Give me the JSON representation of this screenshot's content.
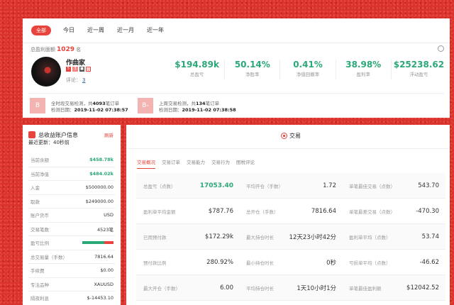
{
  "filters": [
    {
      "label": "全部",
      "active": true
    },
    {
      "label": "今日",
      "active": false
    },
    {
      "label": "近一周",
      "active": false
    },
    {
      "label": "近一月",
      "active": false
    },
    {
      "label": "近一年",
      "active": false
    }
  ],
  "profile": {
    "total_profit_prefix": "总盈利面额",
    "total_profit_value": "1029",
    "total_profit_suffix": "名",
    "name": "作曲家",
    "badges": [
      "5",
      "3",
      "■",
      "◎"
    ],
    "rating_label": "评论：",
    "rating_value": "3"
  },
  "stats": [
    {
      "value": "$194.89k",
      "label": "总盈亏"
    },
    {
      "value": "50.14%",
      "label": "净胜率"
    },
    {
      "value": "0.41%",
      "label": "净值回撤率"
    },
    {
      "value": "38.98%",
      "label": "盈利率"
    },
    {
      "value": "$25238.62",
      "label": "浮动盈亏"
    }
  ],
  "checks": [
    {
      "icon": "B",
      "line1_pre": "全时段交易检测，共",
      "line1_num": "4093",
      "line1_post": "笔订单",
      "line2_label": "检测日期：",
      "line2_date": "2019-11-02 07:38:57"
    },
    {
      "icon": "B-",
      "line1_pre": "上周交易检测，共",
      "line1_num": "134",
      "line1_post": "笔订单",
      "line2_label": "检测日期：",
      "line2_date": "2019-11-02 07:38:58"
    }
  ],
  "account": {
    "title": "总收益账户信息",
    "refresh": "刷新",
    "update": "最近更新：40秒前",
    "loss_ratio": 0.7,
    "rows": [
      {
        "label": "当前余额",
        "value": "$458.78k",
        "style": "green"
      },
      {
        "label": "当前净值",
        "value": "$484.02k",
        "style": "green"
      },
      {
        "label": "入金",
        "value": "$500000.00",
        "style": ""
      },
      {
        "label": "取款",
        "value": "$249000.00",
        "style": ""
      },
      {
        "label": "账户货币",
        "value": "USD",
        "style": ""
      },
      {
        "label": "交易笔数",
        "value": "4523笔",
        "style": ""
      },
      {
        "label": "盈亏比例",
        "value": "",
        "style": "bar"
      },
      {
        "label": "总交易量（手数）",
        "value": "7816.64",
        "style": ""
      },
      {
        "label": "手续费",
        "value": "$0.00",
        "style": ""
      },
      {
        "label": "专注品种",
        "value": "XAUUSD",
        "style": ""
      },
      {
        "label": "隔夜利息",
        "value": "$-14453.10",
        "style": ""
      },
      {
        "label": "",
        "value": "",
        "style": ""
      }
    ]
  },
  "trade": {
    "title": "交易",
    "subtabs": [
      {
        "label": "交易概况",
        "active": true
      },
      {
        "label": "交易订单",
        "active": false
      },
      {
        "label": "交易能力",
        "active": false
      },
      {
        "label": "交易行为",
        "active": false
      },
      {
        "label": "图税评论",
        "active": false
      }
    ],
    "metrics": [
      [
        {
          "label": "总盈亏（点数）",
          "value": "17053.40",
          "style": "green"
        },
        {
          "label": "平均开仓（手数）",
          "value": "1.72",
          "style": ""
        },
        {
          "label": "单笔最佳交易（点数）",
          "value": "543.70",
          "style": ""
        }
      ],
      [
        {
          "label": "盈利单平均金额",
          "value": "$787.76",
          "style": ""
        },
        {
          "label": "总开仓（手数）",
          "value": "7816.64",
          "style": ""
        },
        {
          "label": "单笔最差交易（点数）",
          "value": "-470.30",
          "style": ""
        }
      ],
      [
        {
          "label": "已用预付款",
          "value": "$172.29k",
          "style": ""
        },
        {
          "label": "最大持仓时长",
          "value": "12天23小时42分",
          "style": ""
        },
        {
          "label": "盈利单平均（点数）",
          "value": "53.74",
          "style": ""
        }
      ],
      [
        {
          "label": "预付款比例",
          "value": "280.92%",
          "style": ""
        },
        {
          "label": "最小持仓时长",
          "value": "0秒",
          "style": ""
        },
        {
          "label": "亏损单平均（点数）",
          "value": "-46.62",
          "style": ""
        }
      ],
      [
        {
          "label": "最大开仓（手数）",
          "value": "6.00",
          "style": ""
        },
        {
          "label": "平均持仓时长",
          "value": "1天10小时1分",
          "style": ""
        },
        {
          "label": "单笔最佳盈利额",
          "value": "$12042.52",
          "style": ""
        }
      ]
    ]
  }
}
